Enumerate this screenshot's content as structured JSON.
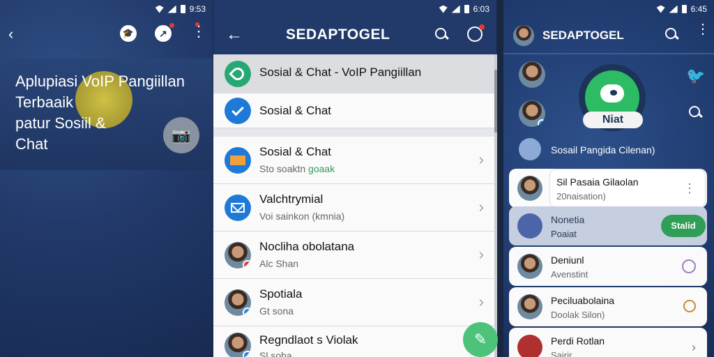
{
  "panel1": {
    "status": {
      "time": "9:53"
    },
    "header": {
      "back_glyph": "‹",
      "icon1": "cap-icon",
      "icon2": "trend-icon",
      "icon3": "more-icon"
    },
    "hero": {
      "title_lines": [
        "Aplupiasi VoIP Pangiillan",
        "Terbaaik",
        "patur Sosiil &",
        "Chat"
      ],
      "cam_icon": "camera-icon"
    }
  },
  "panel2": {
    "status": {
      "time": "6:03"
    },
    "title": "SEDAPTOGEL",
    "rows": [
      {
        "name": "Sosial & Chat  - VoIP Pangiillan",
        "sub": ""
      },
      {
        "name": "Sosial & Chat",
        "sub": ""
      },
      {
        "name": "Sosial & Chat",
        "sub": "Sto soaktn ",
        "sub_green": "goaak"
      },
      {
        "name": "Valchtrymial",
        "sub": "Voi sainkon (kmnia)"
      },
      {
        "name": "Nocliha obolatana",
        "sub": "Alc Shan"
      },
      {
        "name": "Spotiala",
        "sub": "Gt sona"
      },
      {
        "name": "Regndlaot s Violak",
        "sub": "Sl soha"
      }
    ]
  },
  "panel3": {
    "status": {
      "time": "6:45"
    },
    "title": "SEDAPTOGEL",
    "bubble_label": "Niat",
    "list_label": "Sosail Pangida Cilenan)",
    "cards": [
      {
        "name": "Sil Pasaia Gilaolan",
        "sub": "20naisation)"
      },
      {
        "name": "Nonetia",
        "sub": "Poaiat"
      },
      {
        "name": "Deniunl",
        "sub": "Avenstint"
      },
      {
        "name": "Peciluabolaina",
        "sub": "Doolak Silon)"
      },
      {
        "name": "Perdi Rotlan",
        "sub": "Sairir"
      }
    ],
    "pill": "Stalid"
  }
}
